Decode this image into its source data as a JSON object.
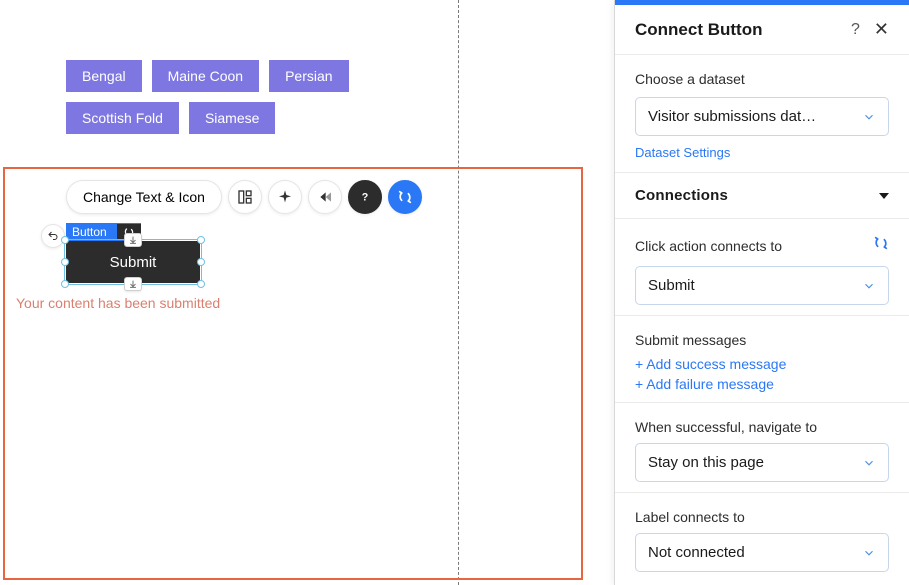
{
  "canvas": {
    "tags": [
      "Bengal",
      "Maine Coon",
      "Persian",
      "Scottish Fold",
      "Siamese"
    ],
    "toolbar": {
      "change_text": "Change Text & Icon"
    },
    "element_badge": "Button",
    "submit_label": "Submit",
    "status_text": "Your content has been submitted"
  },
  "panel": {
    "title": "Connect Button",
    "dataset": {
      "label": "Choose a dataset",
      "value": "Visitor submissions dat…",
      "settings_link": "Dataset Settings"
    },
    "connections": {
      "header": "Connections",
      "click_action": {
        "label": "Click action connects to",
        "value": "Submit"
      },
      "submit_messages": {
        "label": "Submit messages",
        "add_success": "+ Add success message",
        "add_failure": "+ Add failure message"
      },
      "navigate": {
        "label": "When successful, navigate to",
        "value": "Stay on this page"
      },
      "label_connects": {
        "label": "Label connects to",
        "value": "Not connected"
      }
    }
  }
}
